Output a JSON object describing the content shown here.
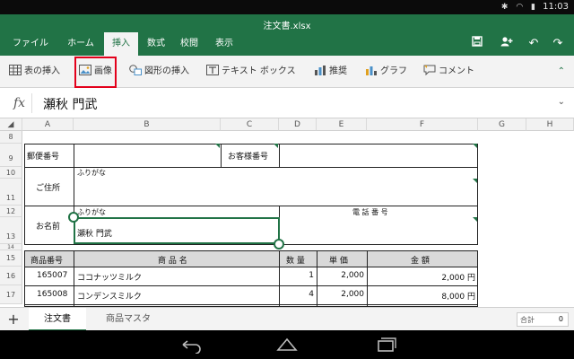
{
  "status": {
    "time": "11:03",
    "icons": [
      "bluetooth-icon",
      "wifi-icon",
      "battery-icon"
    ]
  },
  "title": "注文書.xlsx",
  "tabs": [
    {
      "label": "ファイル"
    },
    {
      "label": "ホーム"
    },
    {
      "label": "挿入"
    },
    {
      "label": "数式"
    },
    {
      "label": "校閲"
    },
    {
      "label": "表示"
    }
  ],
  "active_tab": "挿入",
  "ribbon": {
    "commands": [
      {
        "label": "表の挿入",
        "icon": "table-icon"
      },
      {
        "label": "画像",
        "icon": "picture-icon"
      },
      {
        "label": "図形の挿入",
        "icon": "shapes-icon"
      },
      {
        "label": "テキスト ボックス",
        "icon": "textbox-icon"
      },
      {
        "label": "推奨",
        "icon": "recommended-chart-icon"
      },
      {
        "label": "グラフ",
        "icon": "chart-icon"
      },
      {
        "label": "コメント",
        "icon": "comment-icon"
      }
    ],
    "highlighted": "画像"
  },
  "formula": {
    "fx": "fx",
    "value": "瀬秋 門武"
  },
  "columns": [
    "A",
    "B",
    "C",
    "D",
    "E",
    "F",
    "G",
    "H"
  ],
  "rows": [
    "8",
    "9",
    "10",
    "11",
    "12",
    "13",
    "14",
    "15",
    "16",
    "17"
  ],
  "form": {
    "postal_label": "郵便番号",
    "customer_no_label": "お客様番号",
    "address_label": "ご住所",
    "furigana_1": "ふりがな",
    "furigana_2": "ふりがな",
    "name_label": "お名前",
    "phone_label": "電 話 番 号",
    "name_value": "瀬秋 門武"
  },
  "table": {
    "headers": {
      "code": "商品番号",
      "name": "商 品 名",
      "qty": "数 量",
      "price": "単 価",
      "amount": "金 額"
    },
    "rows": [
      {
        "code": "165007",
        "name": "ココナッツミルク",
        "qty": "1",
        "price": "2,000",
        "amount": "2,000 円"
      },
      {
        "code": "165008",
        "name": "コンデンスミルク",
        "qty": "4",
        "price": "2,000",
        "amount": "8,000 円"
      }
    ]
  },
  "sheets": [
    {
      "label": "注文書"
    },
    {
      "label": "商品マスタ"
    }
  ],
  "active_sheet": "注文書",
  "summary": {
    "label": "合計",
    "value": "0"
  },
  "colors": {
    "accent": "#217346",
    "highlight": "#e3001b"
  }
}
